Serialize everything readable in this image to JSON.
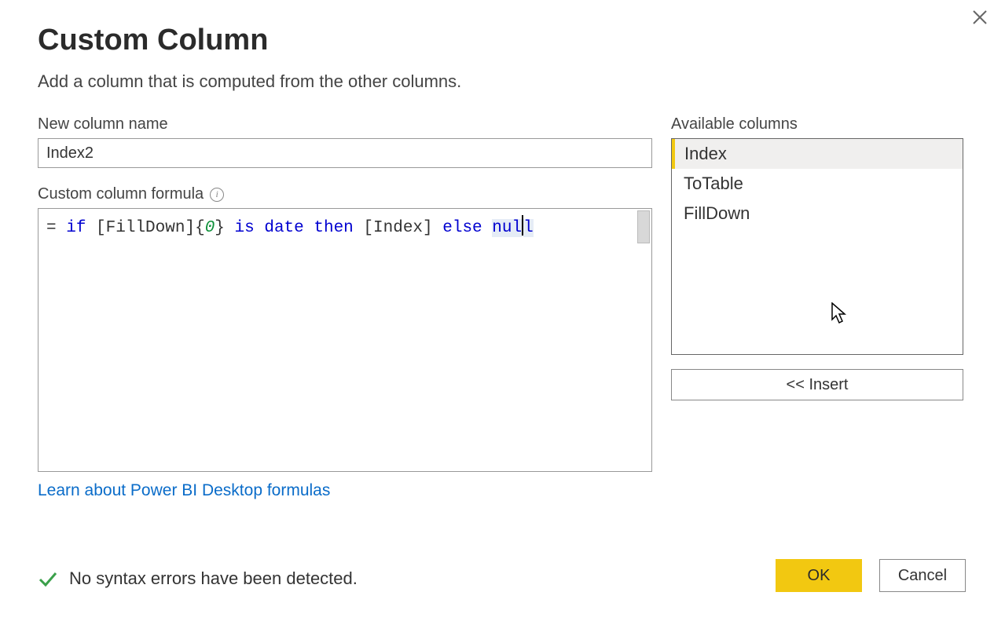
{
  "dialog": {
    "title": "Custom Column",
    "subtitle": "Add a column that is computed from the other columns."
  },
  "name_field": {
    "label": "New column name",
    "value": "Index2"
  },
  "formula": {
    "label": "Custom column formula",
    "tokens": {
      "prefix": "= ",
      "if": "if",
      "sp1": " ",
      "col1": "[FillDown]",
      "brace_idx": "{0}",
      "sp2": " ",
      "is": "is",
      "sp3": " ",
      "date": "date",
      "sp4": " ",
      "then": "then",
      "sp5": " ",
      "col2": "[Index]",
      "sp6": " ",
      "else": "else",
      "sp7": " ",
      "null_a": "nul",
      "null_b": "l"
    }
  },
  "columns": {
    "label": "Available columns",
    "items": [
      "Index",
      "ToTable",
      "FillDown"
    ],
    "selected_index": 0,
    "insert_label": "<< Insert"
  },
  "learn_link": "Learn about Power BI Desktop formulas",
  "status": {
    "text": "No syntax errors have been detected."
  },
  "buttons": {
    "ok": "OK",
    "cancel": "Cancel"
  }
}
